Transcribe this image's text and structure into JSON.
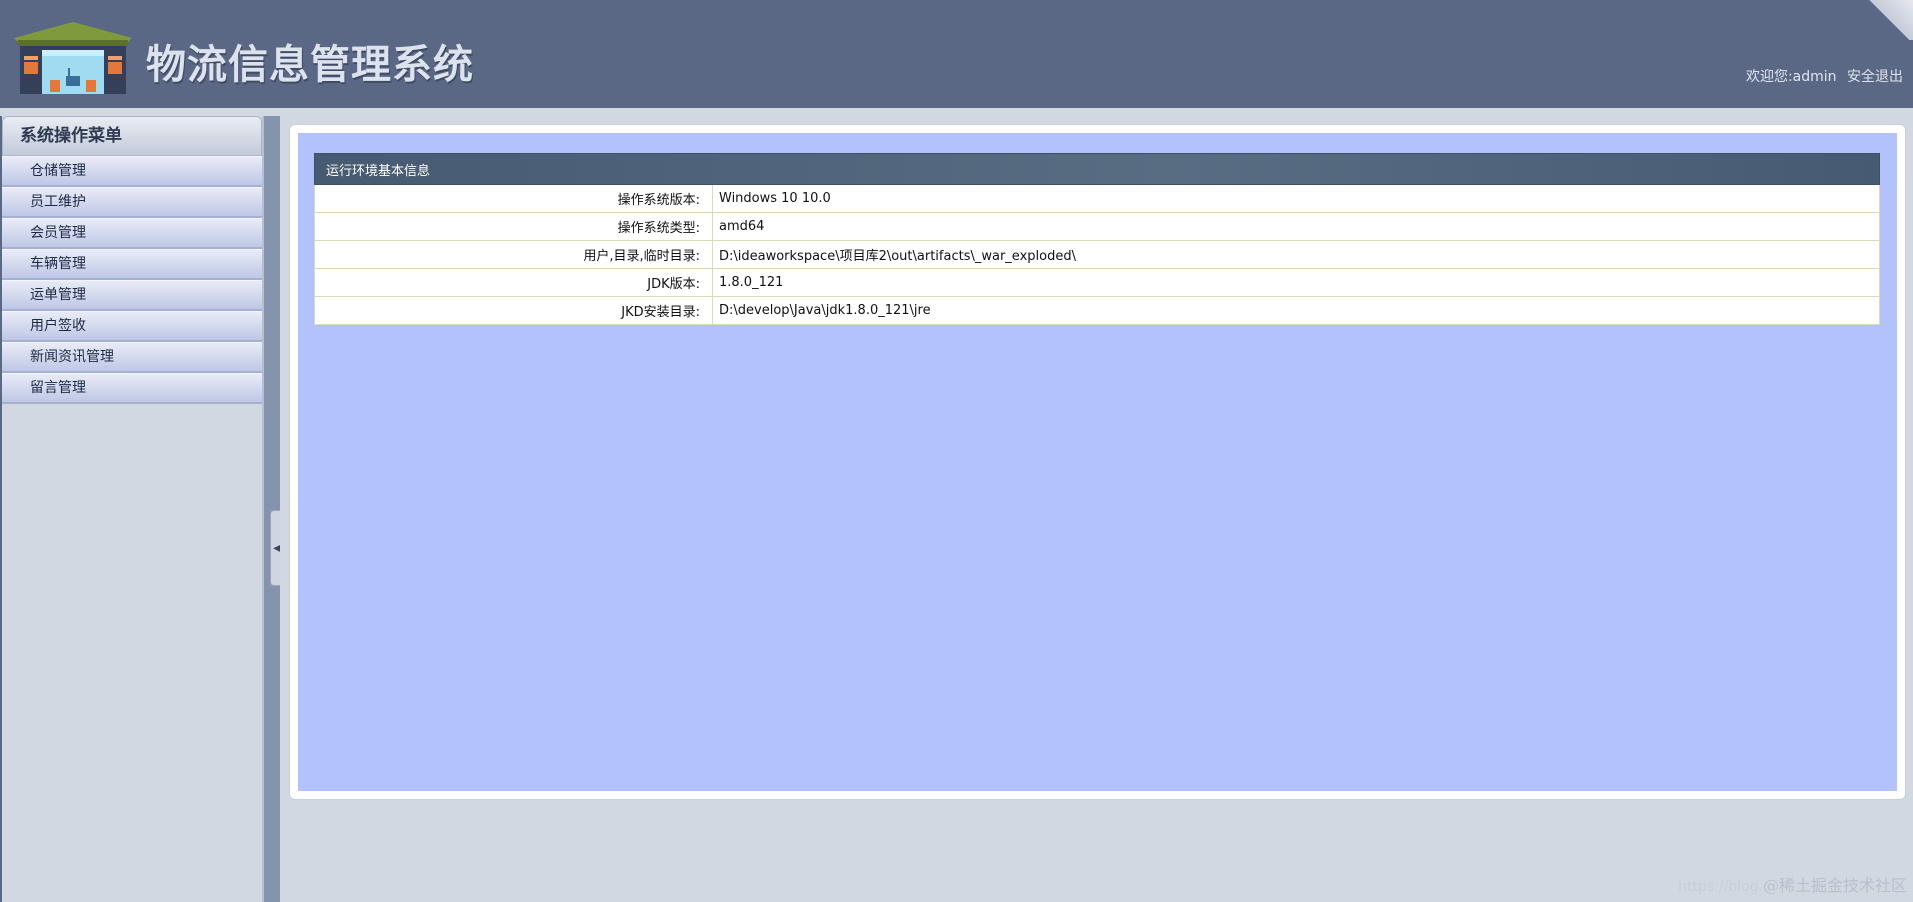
{
  "header": {
    "title": "物流信息管理系统",
    "welcome_text": "欢迎您:admin",
    "logout_label": "安全退出"
  },
  "sidebar": {
    "title": "系统操作菜单",
    "items": [
      {
        "label": "仓储管理"
      },
      {
        "label": "员工维护"
      },
      {
        "label": "会员管理"
      },
      {
        "label": "车辆管理"
      },
      {
        "label": "运单管理"
      },
      {
        "label": "用户签收"
      },
      {
        "label": "新闻资讯管理"
      },
      {
        "label": "留言管理"
      }
    ]
  },
  "main": {
    "table_title": "运行环境基本信息",
    "rows": [
      {
        "label": "操作系统版本:",
        "value": "Windows 10  10.0"
      },
      {
        "label": "操作系统类型:",
        "value": "amd64"
      },
      {
        "label": "用户,目录,临时目录:",
        "value": "D:\\ideaworkspace\\项目库2\\out\\artifacts\\_war_exploded\\"
      },
      {
        "label": "JDK版本:",
        "value": "1.8.0_121"
      },
      {
        "label": "JKD安装目录:",
        "value": "D:\\develop\\Java\\jdk1.8.0_121\\jre"
      }
    ]
  },
  "watermark": {
    "prefix": "https://blog.",
    "text": "@稀土掘金技术社区"
  },
  "icons": {
    "logo": "warehouse-logo-icon",
    "collapse": "collapse-left-icon"
  },
  "colors": {
    "header_bg": "#5a6886",
    "content_bg": "#b3c2fc",
    "table_header_bg": "#4c5f76"
  }
}
